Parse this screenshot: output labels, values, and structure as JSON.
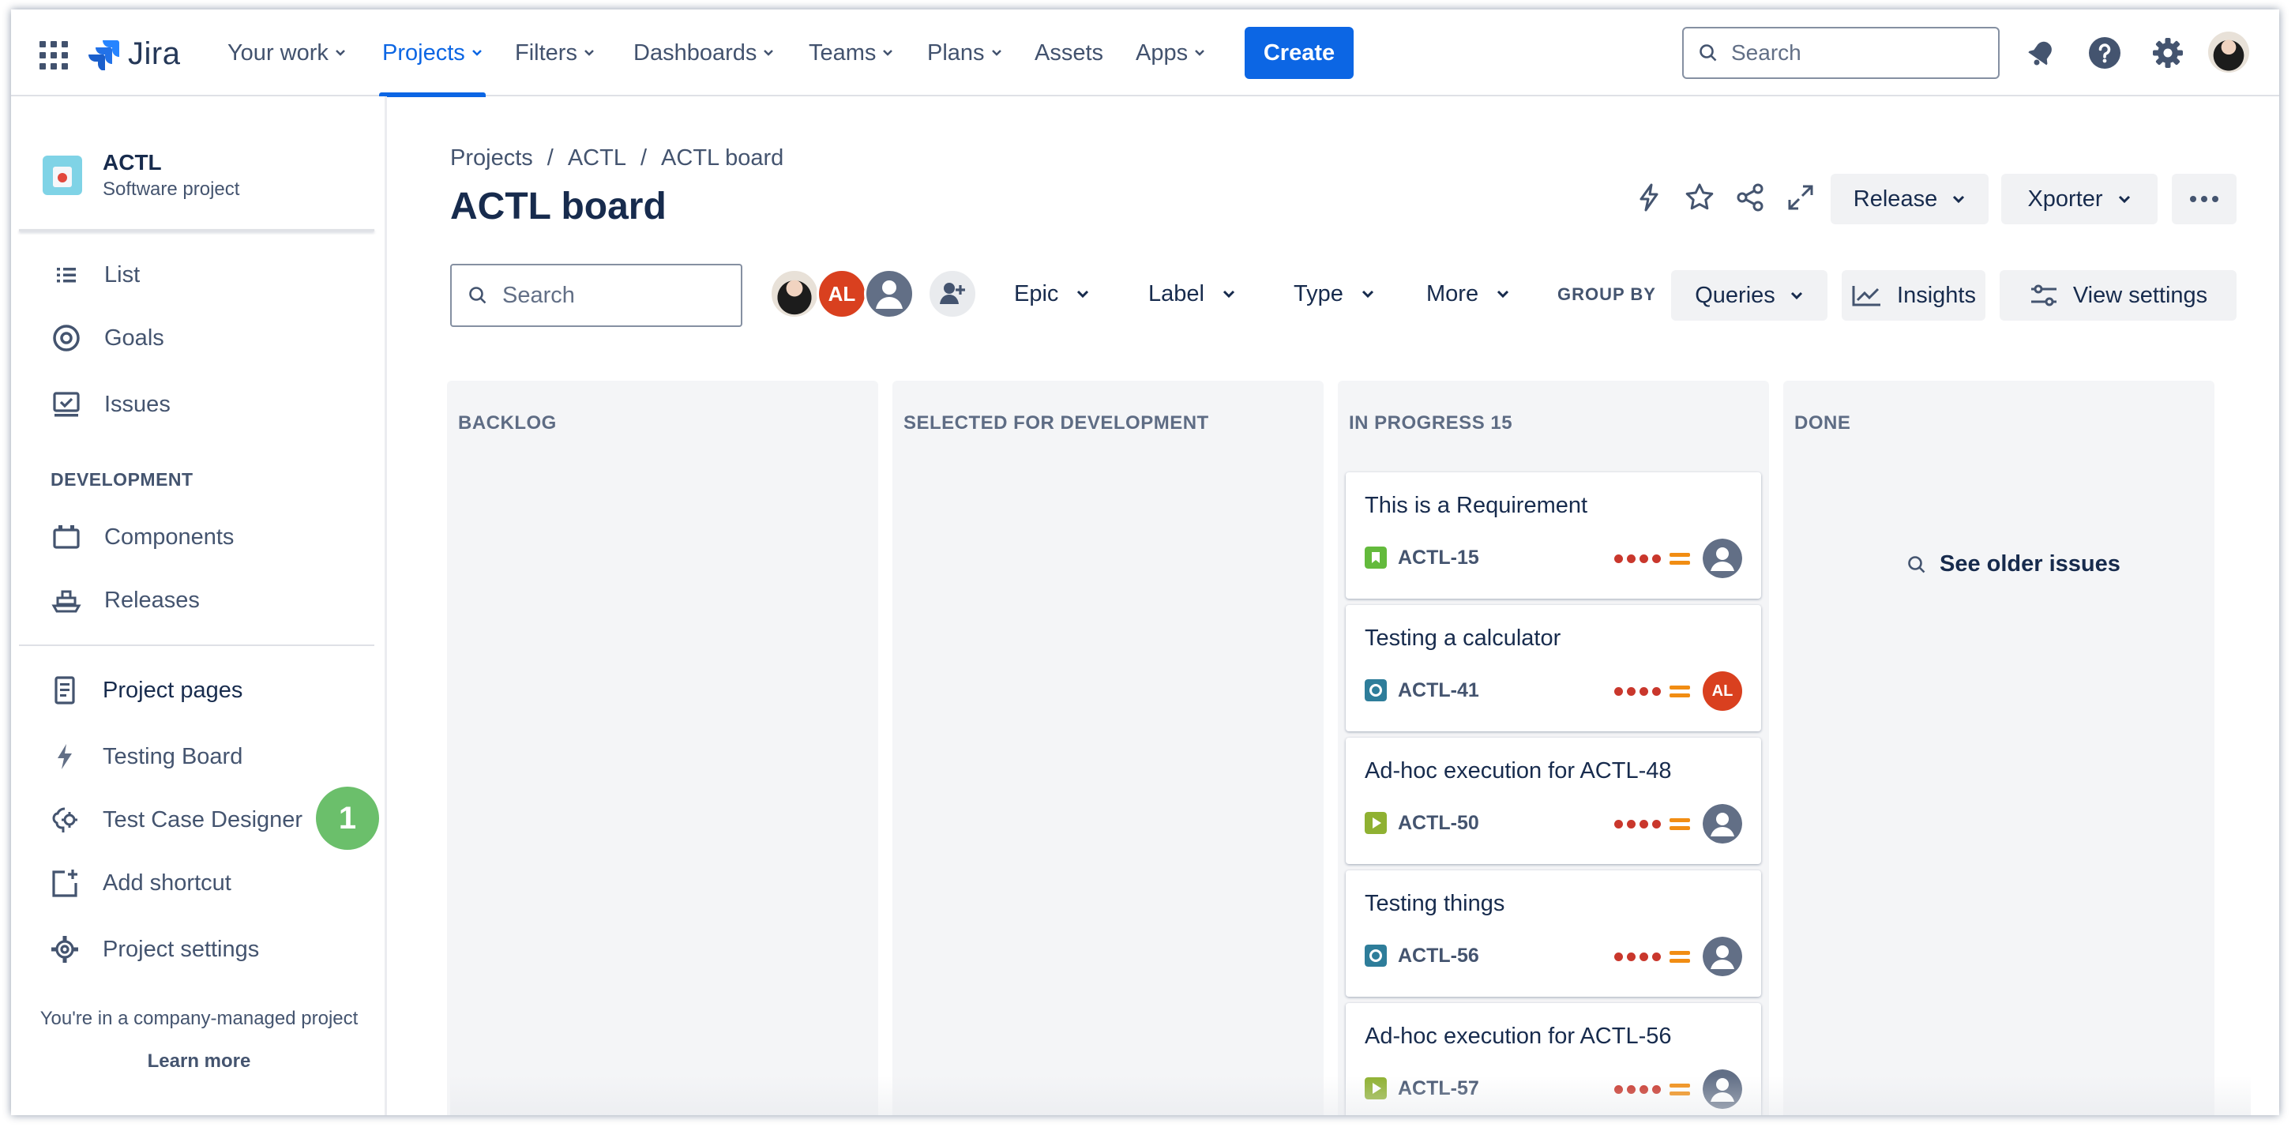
{
  "topnav": {
    "brand": "Jira",
    "items": [
      "Your work",
      "Projects",
      "Filters",
      "Dashboards",
      "Teams",
      "Plans",
      "Assets",
      "Apps"
    ],
    "create_label": "Create",
    "search_placeholder": "Search"
  },
  "sidebar": {
    "project_name": "ACTL",
    "project_type": "Software project",
    "planning_items": [
      "List",
      "Goals",
      "Issues"
    ],
    "section_label": "DEVELOPMENT",
    "dev_items": [
      "Components",
      "Releases"
    ],
    "other_items": [
      "Project pages",
      "Testing Board",
      "Test Case Designer",
      "Add shortcut",
      "Project settings"
    ],
    "badge": "1",
    "footer_text": "You're in a company-managed project",
    "learn_more": "Learn more"
  },
  "header": {
    "breadcrumbs": [
      "Projects",
      "ACTL",
      "ACTL board"
    ],
    "separator": "/",
    "title": "ACTL board",
    "release_label": "Release",
    "xporter_label": "Xporter"
  },
  "toolbar": {
    "search_placeholder": "Search",
    "avatar_al": "AL",
    "filters": [
      "Epic",
      "Label",
      "Type",
      "More"
    ],
    "group_by_label": "GROUP BY",
    "group_by_value": "Queries",
    "insights_label": "Insights",
    "view_settings_label": "View settings"
  },
  "board": {
    "columns": [
      "BACKLOG",
      "SELECTED FOR DEVELOPMENT",
      "IN PROGRESS 15",
      "DONE"
    ],
    "cards": [
      {
        "title": "This is a Requirement",
        "key": "ACTL-15",
        "type": "story",
        "type_color": "#63ba3c",
        "assignee": ""
      },
      {
        "title": "Testing a calculator",
        "key": "ACTL-41",
        "type": "test",
        "type_color": "#2e7d9a",
        "assignee": "AL"
      },
      {
        "title": "Ad-hoc execution for ACTL-48",
        "key": "ACTL-50",
        "type": "execution",
        "type_color": "#8fb132",
        "assignee": ""
      },
      {
        "title": "Testing things",
        "key": "ACTL-56",
        "type": "test",
        "type_color": "#2e7d9a",
        "assignee": ""
      },
      {
        "title": "Ad-hoc execution for ACTL-56",
        "key": "ACTL-57",
        "type": "execution",
        "type_color": "#8fb132",
        "assignee": ""
      }
    ],
    "see_older": "See older issues"
  },
  "colors": {
    "accent": "#0c66e4",
    "priority_highest": "#c9372c",
    "priority_medium": "#f18d13",
    "badge": "#6bbf6b"
  }
}
